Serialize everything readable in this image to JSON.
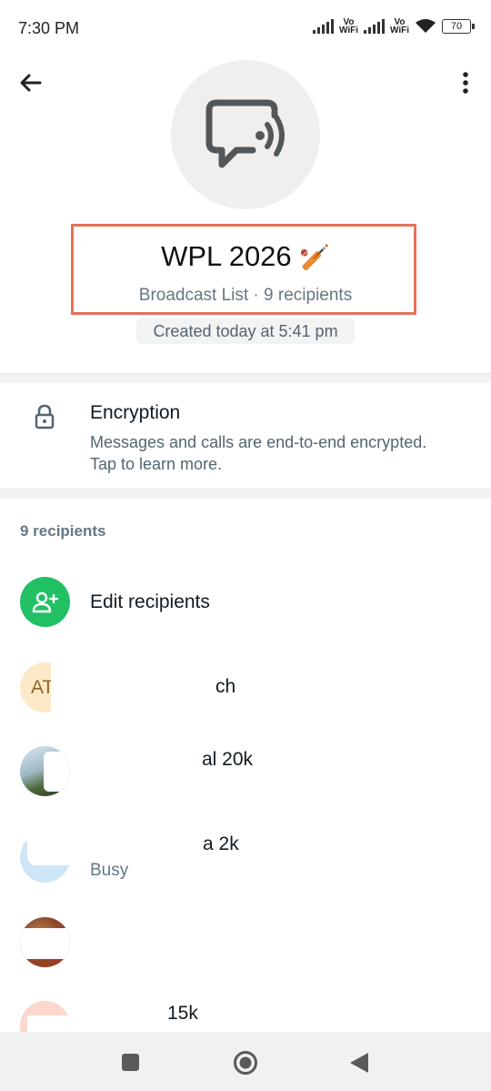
{
  "status_bar": {
    "time": "7:30 PM",
    "vowifi_1": "Vo\nWiFi",
    "vowifi_2": "Vo\nWiFi",
    "battery": "70"
  },
  "header": {
    "back_icon": "arrow-left-icon",
    "menu_icon": "more-vertical-icon"
  },
  "broadcast": {
    "title": "WPL 2026",
    "title_emoji": "🏏",
    "subtitle": "Broadcast List · 9 recipients",
    "created": "Created today at 5:41 pm",
    "highlight_color": "#e5715a"
  },
  "encryption": {
    "title": "Encryption",
    "description": "Messages and calls are end-to-end encrypted. Tap to learn more."
  },
  "recipients": {
    "count_label": "9 recipients",
    "edit_label": "Edit recipients",
    "accent": "#21c063",
    "contacts": [
      {
        "avatar_initials": "AT",
        "name_visible": "ch",
        "status": ""
      },
      {
        "avatar_initials": "",
        "name_visible": "al 20k",
        "status": ""
      },
      {
        "avatar_initials": "",
        "name_visible": "a 2k",
        "status": "Busy"
      },
      {
        "avatar_initials": "",
        "name_visible": "",
        "status": ""
      },
      {
        "avatar_initials": "",
        "name_visible": "15k",
        "status": ""
      }
    ]
  },
  "nav": {
    "recents_icon": "square-icon",
    "home_icon": "circle-home-icon",
    "back_icon": "triangle-back-icon"
  }
}
